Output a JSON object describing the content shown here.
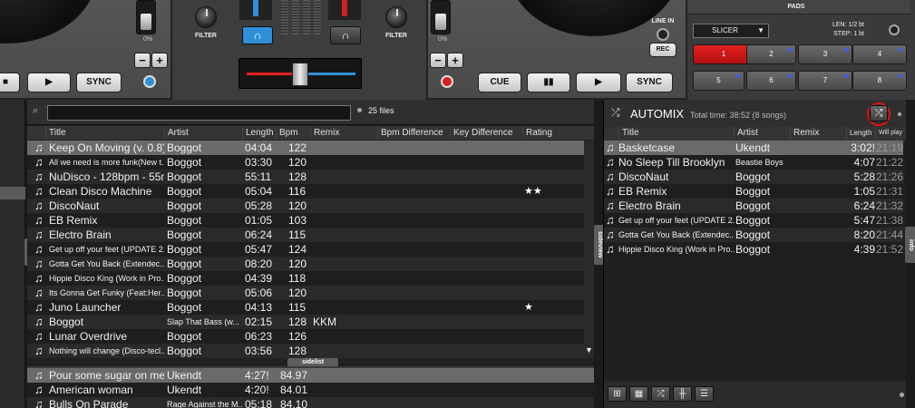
{
  "deck_left": {
    "pitch_percent": "0%",
    "minus": "−",
    "plus": "+",
    "buttons": {
      "stop": "■",
      "play": "▶",
      "sync": "SYNC"
    }
  },
  "mixer": {
    "filter_left": "FILTER",
    "filter_right": "FILTER",
    "headphone_icon": "🎧"
  },
  "deck_right": {
    "pitch_percent": "0%",
    "minus": "−",
    "plus": "+",
    "line_in": "LINE IN",
    "rec": "REC",
    "buttons": {
      "cue": "CUE",
      "pause": "▮▮",
      "play": "▶",
      "sync": "SYNC"
    }
  },
  "pads": {
    "title": "PADS",
    "mode": "SLICER",
    "len": "LEN: 1/2 bt",
    "step": "STEP: 1 bt",
    "labels": [
      "1",
      "2",
      "3",
      "4",
      "5",
      "6",
      "7",
      "8"
    ]
  },
  "side_tabs": {
    "folders": "folders",
    "sideview": "sideview",
    "sidelist": "sidelist",
    "info": "info"
  },
  "browser": {
    "search_value": "",
    "file_count": "25 files",
    "columns": [
      "Title",
      "Artist",
      "Length",
      "Bpm",
      "Remix",
      "Bpm Difference",
      "Key Difference",
      "Rating"
    ],
    "rows": [
      {
        "title": "Keep On Moving (v. 0.8)",
        "artist": "Boggot",
        "length": "04:04",
        "bpm": "122",
        "remix": "",
        "rating": "",
        "small": false,
        "sel": true
      },
      {
        "title": "All we need is more funk(New t...",
        "artist": "Boggot",
        "length": "03:30",
        "bpm": "120",
        "remix": "",
        "rating": "",
        "small": true
      },
      {
        "title": "NuDisco - 128bpm - 55m",
        "artist": "Boggot",
        "length": "55:11",
        "bpm": "128",
        "remix": "",
        "rating": "",
        "small": false
      },
      {
        "title": "Clean Disco Machine",
        "artist": "Boggot",
        "length": "05:04",
        "bpm": "116",
        "remix": "",
        "rating": "★★",
        "small": false
      },
      {
        "title": "DiscoNaut",
        "artist": "Boggot",
        "length": "05:28",
        "bpm": "120",
        "remix": "",
        "rating": "",
        "small": false
      },
      {
        "title": "EB Remix",
        "artist": "Boggot",
        "length": "01:05",
        "bpm": "103",
        "remix": "",
        "rating": "",
        "small": false
      },
      {
        "title": "Electro Brain",
        "artist": "Boggot",
        "length": "06:24",
        "bpm": "115",
        "remix": "",
        "rating": "",
        "small": false
      },
      {
        "title": "Get up off your feet (UPDATE 2...",
        "artist": "Boggot",
        "length": "05:47",
        "bpm": "124",
        "remix": "",
        "rating": "",
        "small": true
      },
      {
        "title": "Gotta Get You Back (Extendec...",
        "artist": "Boggot",
        "length": "08:20",
        "bpm": "120",
        "remix": "",
        "rating": "",
        "small": true
      },
      {
        "title": "Hippie Disco King (Work in Pro...",
        "artist": "Boggot",
        "length": "04:39",
        "bpm": "118",
        "remix": "",
        "rating": "",
        "small": true
      },
      {
        "title": "Its Gonna Get Funky (Feat:Her...",
        "artist": "Boggot",
        "length": "05:06",
        "bpm": "120",
        "remix": "",
        "rating": "",
        "small": true
      },
      {
        "title": "Juno Launcher",
        "artist": "Boggot",
        "length": "04:13",
        "bpm": "115",
        "remix": "",
        "rating": "★",
        "small": false
      },
      {
        "title": "Boggot",
        "artist": "Slap That Bass (w...",
        "length": "02:15",
        "bpm": "128",
        "remix": "KKM",
        "rating": "",
        "small": false,
        "artist_small": true
      },
      {
        "title": "Lunar Overdrive",
        "artist": "Boggot",
        "length": "06:23",
        "bpm": "126",
        "remix": "",
        "rating": "",
        "small": false
      },
      {
        "title": "Nothing will change (Disco-tecl...",
        "artist": "Boggot",
        "length": "03:56",
        "bpm": "128",
        "remix": "",
        "rating": "",
        "small": true
      }
    ],
    "sidelist_rows": [
      {
        "title": "Pour some sugar on me",
        "artist": "Ukendt",
        "length": "4:27!",
        "bpm": "84.97",
        "sel": true
      },
      {
        "title": "American woman",
        "artist": "Ukendt",
        "length": "4:20!",
        "bpm": "84.01"
      },
      {
        "title": "Bulls On Parade",
        "artist": "Rage Against the M...",
        "length": "05:18",
        "bpm": "84.10",
        "artist_small": true
      }
    ]
  },
  "automix": {
    "title": "AUTOMIX",
    "total": "Total time: 38:52 (8 songs)",
    "columns": [
      "Title",
      "Artist",
      "Remix",
      "Length",
      "Will play"
    ],
    "rows": [
      {
        "title": "Basketcase",
        "artist": "Ukendt",
        "length": "3:02!",
        "play": "21:19",
        "sel": true
      },
      {
        "title": "No Sleep Till Brooklyn",
        "artist": "Beastie Boys",
        "length": "4:07",
        "play": "21:22",
        "artist_small": true
      },
      {
        "title": "DiscoNaut",
        "artist": "Boggot",
        "length": "5:28",
        "play": "21:26"
      },
      {
        "title": "EB Remix",
        "artist": "Boggot",
        "length": "1:05",
        "play": "21:31"
      },
      {
        "title": "Electro Brain",
        "artist": "Boggot",
        "length": "6:24",
        "play": "21:32"
      },
      {
        "title": "Get up off your feet (UPDATE 2...",
        "artist": "Boggot",
        "length": "5:47",
        "play": "21:38",
        "small": true
      },
      {
        "title": "Gotta Get You Back (Extendec...",
        "artist": "Boggot",
        "length": "8:20",
        "play": "21:44",
        "small": true
      },
      {
        "title": "Hippie Disco King (Work in Pro...",
        "artist": "Boggot",
        "length": "4:39",
        "play": "21:52",
        "small": true
      }
    ],
    "toolbar_icons": [
      "add-icon",
      "grid-icon",
      "shuffle-icon",
      "split-icon",
      "list-icon"
    ]
  },
  "colors": {
    "accent_blue": "#2f8fd8",
    "pad_red": "#e31f1f",
    "annotation_red": "#e01010"
  }
}
